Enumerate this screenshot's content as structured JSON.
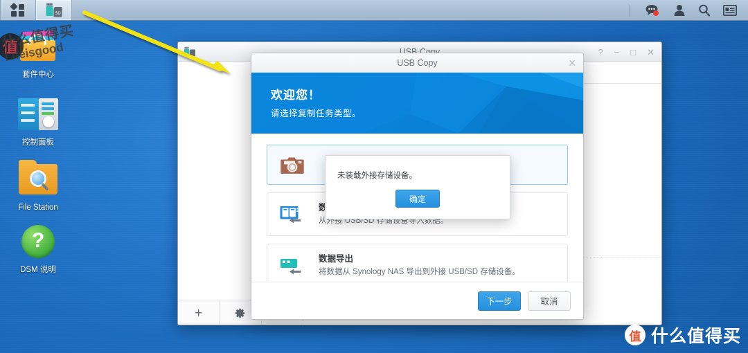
{
  "taskbar": {
    "main_menu_icon": "grid-menu-icon",
    "usb_copy_icon": "usb-sd-icon",
    "right_icons": [
      {
        "name": "chat-icon",
        "label": "Chat"
      },
      {
        "name": "user-icon",
        "label": "Options"
      },
      {
        "name": "search-icon",
        "label": "Search"
      },
      {
        "name": "widget-icon",
        "label": "Widgets"
      }
    ]
  },
  "desktop": {
    "icons": [
      {
        "name": "package-center",
        "label": "套件中心"
      },
      {
        "name": "control-panel",
        "label": "控制面板"
      },
      {
        "name": "file-station",
        "label": "File Station"
      },
      {
        "name": "dsm-help",
        "label": "DSM 说明",
        "glyph": "?"
      }
    ],
    "watermark": {
      "line1": "什么值得买",
      "line2": "Lifeisgood",
      "badge": "值"
    },
    "corner_watermark": {
      "badge": "值",
      "text": "什么值得买"
    }
  },
  "background_window": {
    "title": "USB Copy",
    "controls": {
      "help": "?",
      "minimize": "−",
      "maximize": "□",
      "close": "✕"
    },
    "toolbar": {
      "add": "+",
      "settings": "⚙",
      "remove": "▬"
    }
  },
  "modal": {
    "title": "USB Copy",
    "close": "✕",
    "banner": {
      "heading": "欢迎您！",
      "subheading": "请选择复制任务类型。"
    },
    "options": [
      {
        "name": "photo-import",
        "icon": "camera-icon",
        "title": "",
        "desc": "",
        "selected": true
      },
      {
        "name": "data-import",
        "icon": "nas-import-icon",
        "title": "数据导入",
        "desc": "从外接 USB/SD 存储设备导入数据。",
        "selected": false
      },
      {
        "name": "data-export",
        "icon": "usb-export-icon",
        "title": "数据导出",
        "desc": "将数据从 Synology NAS 导出到外接 USB/SD 存储设备。",
        "selected": false
      }
    ],
    "footer": {
      "next": "下一步",
      "cancel": "取消"
    }
  },
  "alert": {
    "message": "未装载外接存储设备。",
    "ok": "确定"
  },
  "colors": {
    "accent": "#2490dd",
    "banner": "#0a84dc",
    "desktop": "#1f72c4",
    "taskbar": "#a8bed4",
    "arrow": "#f2e314",
    "camera": "#a8674f",
    "nas": "#1f8ae0",
    "usb_export": "#1fbfb8"
  }
}
